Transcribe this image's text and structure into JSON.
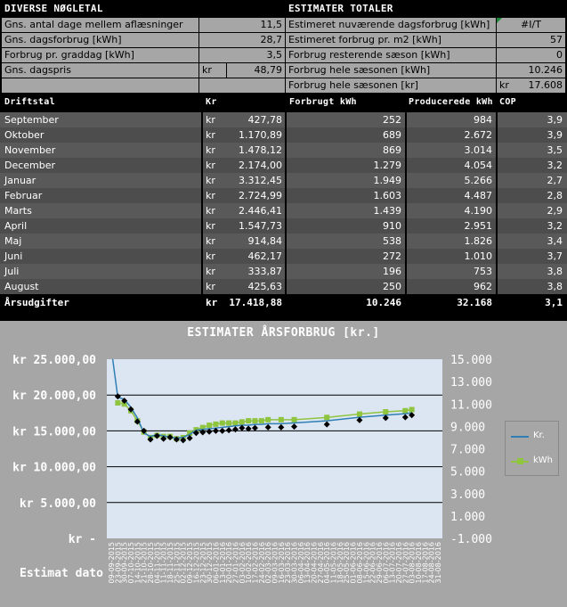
{
  "left_section": {
    "header": "DIVERSE NØGLETAL",
    "rows": [
      {
        "label": "Gns. antal dage mellem aflæsninger",
        "unit": "",
        "value": "11,5"
      },
      {
        "label": "Gns. dagsforbrug [kWh]",
        "unit": "",
        "value": "28,7"
      },
      {
        "label": "Forbrug pr. graddag [kWh]",
        "unit": "",
        "value": "3,5"
      },
      {
        "label": "Gns. dagspris",
        "unit": "kr",
        "value": "48,79"
      }
    ]
  },
  "right_section": {
    "header": "ESTIMATER TOTALER",
    "rows": [
      {
        "label": "Estimeret nuværende dagsforbrug [kWh]",
        "unit": "",
        "value": "#I/T"
      },
      {
        "label": "Estimeret forbrug pr. m2 [kWh]",
        "unit": "",
        "value": "57"
      },
      {
        "label": "Forbrug resterende sæson [kWh]",
        "unit": "",
        "value": "0"
      },
      {
        "label": "Forbrug hele sæsonen [kWh]",
        "unit": "",
        "value": "10.246"
      },
      {
        "label": "Forbrug hele sæsonen [kr]",
        "unit": "kr",
        "value": "17.608"
      }
    ]
  },
  "table": {
    "headers": {
      "month": "Driftstal",
      "kr": "Kr",
      "kwh": "Forbrugt kWh",
      "prod": "Producerede kWh",
      "cop": "COP"
    },
    "rows": [
      {
        "month": "September",
        "unit": "kr",
        "kr": "427,78",
        "kwh": "252",
        "prod": "984",
        "cop": "3,9"
      },
      {
        "month": "Oktober",
        "unit": "kr",
        "kr": "1.170,89",
        "kwh": "689",
        "prod": "2.672",
        "cop": "3,9"
      },
      {
        "month": "November",
        "unit": "kr",
        "kr": "1.478,12",
        "kwh": "869",
        "prod": "3.014",
        "cop": "3,5"
      },
      {
        "month": "December",
        "unit": "kr",
        "kr": "2.174,00",
        "kwh": "1.279",
        "prod": "4.054",
        "cop": "3,2"
      },
      {
        "month": "Januar",
        "unit": "kr",
        "kr": "3.312,45",
        "kwh": "1.949",
        "prod": "5.266",
        "cop": "2,7"
      },
      {
        "month": "Februar",
        "unit": "kr",
        "kr": "2.724,99",
        "kwh": "1.603",
        "prod": "4.487",
        "cop": "2,8"
      },
      {
        "month": "Marts",
        "unit": "kr",
        "kr": "2.446,41",
        "kwh": "1.439",
        "prod": "4.190",
        "cop": "2,9"
      },
      {
        "month": "April",
        "unit": "kr",
        "kr": "1.547,73",
        "kwh": "910",
        "prod": "2.951",
        "cop": "3,2"
      },
      {
        "month": "Maj",
        "unit": "kr",
        "kr": "914,84",
        "kwh": "538",
        "prod": "1.826",
        "cop": "3,4"
      },
      {
        "month": "Juni",
        "unit": "kr",
        "kr": "462,17",
        "kwh": "272",
        "prod": "1.010",
        "cop": "3,7"
      },
      {
        "month": "Juli",
        "unit": "kr",
        "kr": "333,87",
        "kwh": "196",
        "prod": "753",
        "cop": "3,8"
      },
      {
        "month": "August",
        "unit": "kr",
        "kr": "425,63",
        "kwh": "250",
        "prod": "962",
        "cop": "3,8"
      }
    ],
    "total": {
      "month": "Årsudgifter",
      "unit": "kr",
      "kr": "17.418,88",
      "kwh": "10.246",
      "prod": "32.168",
      "cop": "3,1"
    }
  },
  "colors": {
    "kr_series": "#2f7fb5",
    "kwh_series": "#8fc43f",
    "plot_bg": "#dce6f2",
    "panel_bg": "#a6a6a6",
    "header_bg": "#000000"
  },
  "chart_data": {
    "type": "line",
    "title": "ESTIMATER ÅRSFORBRUG [kr.]",
    "xlabel": "Estimat dato",
    "ylabel": "",
    "ylim": [
      0,
      25000
    ],
    "y2lim": [
      -1000,
      15000
    ],
    "yticks_left": [
      "kr 25.000,00",
      "kr 20.000,00",
      "kr 15.000,00",
      "kr 10.000,00",
      "kr 5.000,00",
      "kr -"
    ],
    "yticks_right": [
      "15.000",
      "13.000",
      "11.000",
      "9.000",
      "7.000",
      "5.000",
      "3.000",
      "1.000",
      "-1.000"
    ],
    "x_labels": [
      "09-09-2015",
      "23-09-2015",
      "30-09-2015",
      "07-10-2015",
      "14-10-2015",
      "21-10-2015",
      "28-10-2015",
      "04-11-2015",
      "11-11-2015",
      "18-11-2015",
      "25-11-2015",
      "02-12-2015",
      "09-12-2015",
      "16-12-2015",
      "23-12-2015",
      "30-12-2015",
      "06-01-2016",
      "13-01-2016",
      "20-01-2016",
      "27-01-2016",
      "03-02-2016",
      "10-02-2016",
      "17-02-2016",
      "24-02-2016",
      "02-03-2016",
      "09-03-2016",
      "16-03-2016",
      "23-03-2016",
      "30-03-2016",
      "06-04-2016",
      "13-04-2016",
      "20-04-2016",
      "27-04-2016",
      "04-05-2016",
      "11-05-2016",
      "18-05-2016",
      "25-05-2016",
      "01-06-2016",
      "08-06-2016",
      "15-06-2016",
      "22-06-2016",
      "29-06-2016",
      "06-07-2016",
      "13-07-2016",
      "20-07-2016",
      "27-07-2016",
      "03-08-2016",
      "10-08-2016",
      "17-08-2016",
      "24-08-2016",
      "31-08-2016"
    ],
    "series": [
      {
        "name": "Kr.",
        "axis": "left",
        "values": [
          [
            0,
            26500
          ],
          [
            1,
            19700
          ],
          [
            2,
            19400
          ],
          [
            3,
            18300
          ],
          [
            4,
            16800
          ],
          [
            5,
            14700
          ],
          [
            6,
            14200
          ],
          [
            7,
            14500
          ],
          [
            8,
            14300
          ],
          [
            9,
            14100
          ],
          [
            10,
            14000
          ],
          [
            11,
            14100
          ],
          [
            12,
            14500
          ],
          [
            13,
            15100
          ],
          [
            14,
            15200
          ],
          [
            15,
            15300
          ],
          [
            16,
            15400
          ],
          [
            17,
            15500
          ],
          [
            18,
            15600
          ],
          [
            19,
            15700
          ],
          [
            20,
            15800
          ],
          [
            21,
            15800
          ],
          [
            22,
            15900
          ],
          [
            23,
            15900
          ],
          [
            24,
            16000
          ],
          [
            26,
            16000
          ],
          [
            28,
            16100
          ],
          [
            33,
            16400
          ],
          [
            38,
            16900
          ],
          [
            42,
            17200
          ],
          [
            45,
            17400
          ],
          [
            46,
            17500
          ]
        ]
      },
      {
        "name": "kWh",
        "axis": "right",
        "values": [
          [
            1,
            11100
          ],
          [
            2,
            11000
          ],
          [
            3,
            10400
          ],
          [
            4,
            9500
          ],
          [
            5,
            8500
          ],
          [
            6,
            8000
          ],
          [
            7,
            8200
          ],
          [
            8,
            8100
          ],
          [
            9,
            8100
          ],
          [
            10,
            7900
          ],
          [
            11,
            8000
          ],
          [
            12,
            8400
          ],
          [
            13,
            8700
          ],
          [
            14,
            8900
          ],
          [
            15,
            9100
          ],
          [
            16,
            9200
          ],
          [
            17,
            9300
          ],
          [
            18,
            9300
          ],
          [
            19,
            9300
          ],
          [
            20,
            9400
          ],
          [
            21,
            9500
          ],
          [
            22,
            9500
          ],
          [
            23,
            9500
          ],
          [
            24,
            9600
          ],
          [
            26,
            9600
          ],
          [
            28,
            9600
          ],
          [
            33,
            9800
          ],
          [
            38,
            10100
          ],
          [
            42,
            10300
          ],
          [
            45,
            10400
          ],
          [
            46,
            10500
          ]
        ]
      },
      {
        "name": "markers",
        "axis": "left",
        "values": [
          [
            1,
            19800
          ],
          [
            2,
            19200
          ],
          [
            3,
            18000
          ],
          [
            4,
            16300
          ],
          [
            5,
            15000
          ],
          [
            6,
            13800
          ],
          [
            7,
            14300
          ],
          [
            8,
            13900
          ],
          [
            9,
            14100
          ],
          [
            10,
            13800
          ],
          [
            11,
            13700
          ],
          [
            12,
            14000
          ],
          [
            13,
            14700
          ],
          [
            14,
            14800
          ],
          [
            15,
            14900
          ],
          [
            16,
            15000
          ],
          [
            17,
            15000
          ],
          [
            18,
            15100
          ],
          [
            19,
            15200
          ],
          [
            20,
            15400
          ],
          [
            21,
            15300
          ],
          [
            22,
            15400
          ],
          [
            24,
            15500
          ],
          [
            26,
            15500
          ],
          [
            28,
            15600
          ],
          [
            33,
            15900
          ],
          [
            38,
            16500
          ],
          [
            42,
            16800
          ],
          [
            45,
            16900
          ],
          [
            46,
            17200
          ]
        ]
      }
    ]
  }
}
